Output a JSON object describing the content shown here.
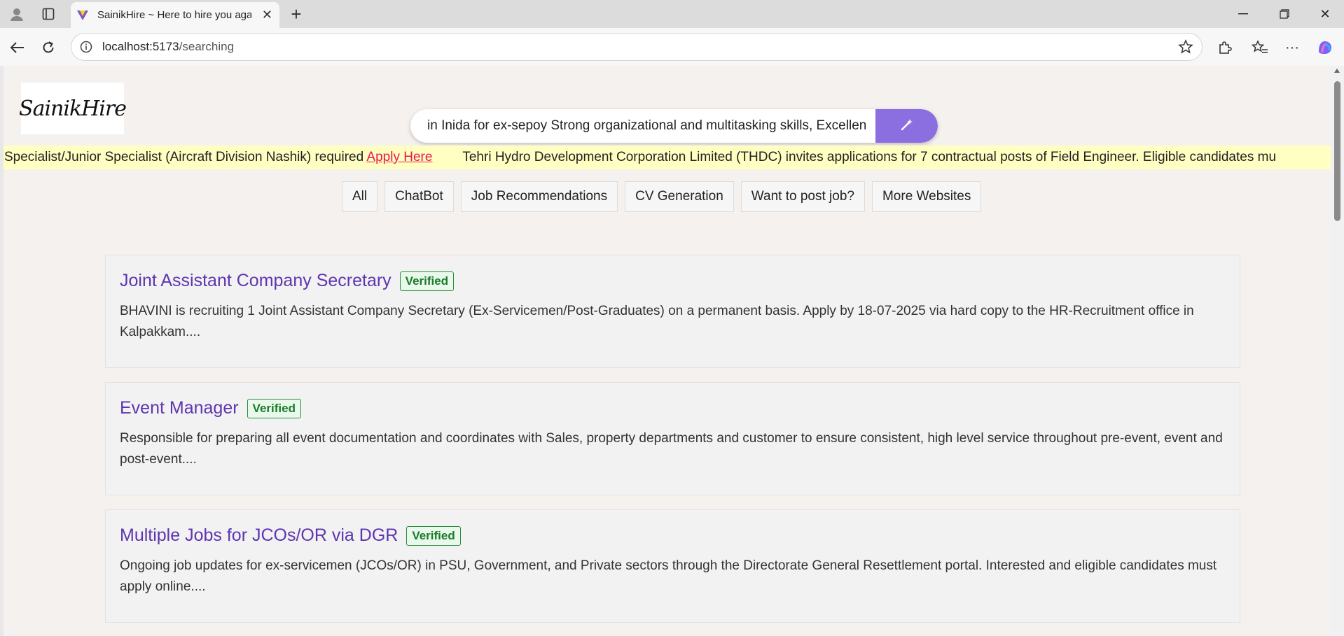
{
  "browser": {
    "tab_title": "SainikHire ~ Here to hire you again",
    "url_host": "localhost:5173",
    "url_path": "/searching"
  },
  "page": {
    "logo_text": "SainikHire",
    "search": {
      "value": "in Inida for ex-sepoy Strong organizational and multitasking skills, Excellent communication",
      "button_icon": "magic-wand-icon"
    },
    "ticker": {
      "item1_text": "Specialist/Junior Specialist (Aircraft Division Nashik) required",
      "item1_link": "Apply Here",
      "item2_text": "Tehri Hydro Development Corporation Limited (THDC) invites applications for 7 contractual posts of Field Engineer. Eligible candidates mu"
    },
    "filters": [
      "All",
      "ChatBot",
      "Job Recommendations",
      "CV Generation",
      "Want to post job?",
      "More Websites"
    ],
    "results": [
      {
        "title": "Joint Assistant Company Secretary",
        "badge": "Verified",
        "description": "BHAVINI is recruiting 1 Joint Assistant Company Secretary (Ex-Servicemen/Post-Graduates) on a permanent basis. Apply by 18-07-2025 via hard copy to the HR-Recruitment office in Kalpakkam...."
      },
      {
        "title": "Event Manager",
        "badge": "Verified",
        "description": "Responsible for preparing all event documentation and coordinates with Sales, property departments and customer to ensure consistent, high level service throughout pre-event, event and post-event...."
      },
      {
        "title": "Multiple Jobs for JCOs/OR via DGR",
        "badge": "Verified",
        "description": "Ongoing job updates for ex-servicemen (JCOs/OR) in PSU, Government, and Private sectors through the Directorate General Resettlement portal. Interested and eligible candidates must apply online...."
      }
    ]
  },
  "colors": {
    "accent": "#8b6fe0",
    "title": "#5e35b1",
    "verified": "#1b7a2b",
    "ticker_bg": "#ffffc2",
    "link": "#e8174d"
  }
}
